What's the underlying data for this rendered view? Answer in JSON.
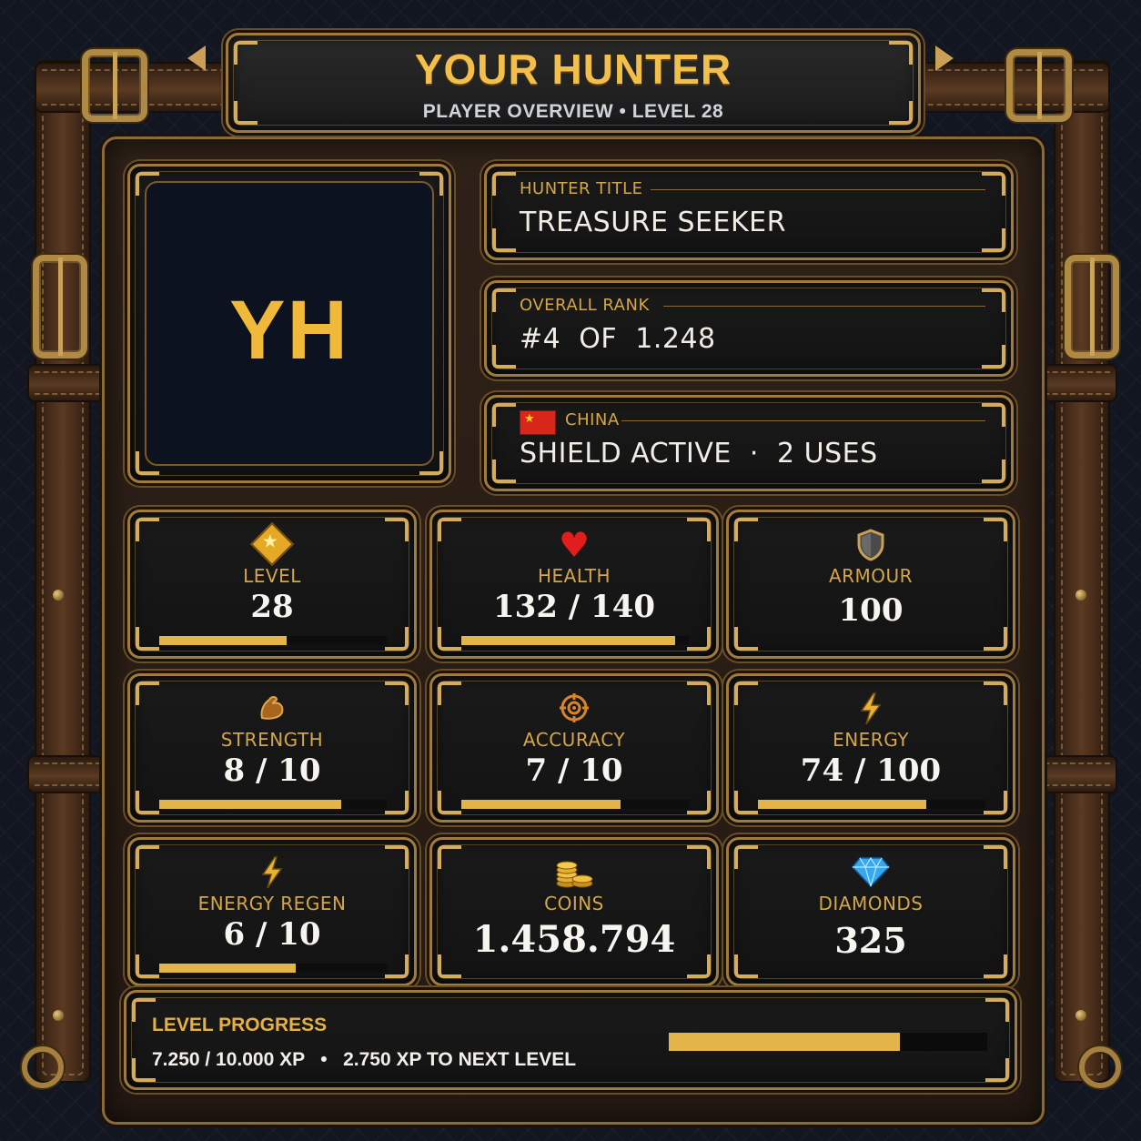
{
  "header": {
    "title": "YOUR HUNTER",
    "subtitle": "PLAYER OVERVIEW  •  LEVEL 28"
  },
  "avatar": {
    "initials": "YH"
  },
  "info": [
    {
      "label": "HUNTER TITLE",
      "value": "TREASURE SEEKER"
    },
    {
      "label": "OVERALL RANK",
      "value": "#4  OF  1.248"
    },
    {
      "label": "CHINA",
      "value": "SHIELD ACTIVE  ·  2 USES",
      "flag_icon": "china-flag-icon"
    }
  ],
  "stats": [
    {
      "name": "level",
      "label": "LEVEL",
      "value": "28",
      "icon": "star-icon",
      "fill": 0.56
    },
    {
      "name": "health",
      "label": "HEALTH",
      "value": "132 / 140",
      "icon": "heart-icon",
      "fill": 0.94
    },
    {
      "name": "armour",
      "label": "ARMOUR",
      "value": "100",
      "icon": "shield-icon",
      "fill": null
    },
    {
      "name": "strength",
      "label": "STRENGTH",
      "value": "8 / 10",
      "icon": "flexed-arm-icon",
      "fill": 0.8
    },
    {
      "name": "accuracy",
      "label": "ACCURACY",
      "value": "7 / 10",
      "icon": "crosshair-icon",
      "fill": 0.7
    },
    {
      "name": "energy",
      "label": "ENERGY",
      "value": "74 / 100",
      "icon": "lightning-icon",
      "fill": 0.74
    },
    {
      "name": "energy-regen",
      "label": "ENERGY REGEN",
      "value": "6 / 10",
      "icon": "lightning-icon",
      "fill": 0.6
    },
    {
      "name": "coins",
      "label": "COINS",
      "value": "1.458.794",
      "icon": "coins-icon",
      "fill": null
    },
    {
      "name": "diamonds",
      "label": "DIAMONDS",
      "value": "325",
      "icon": "diamond-icon",
      "fill": null
    }
  ],
  "progress": {
    "label": "LEVEL PROGRESS",
    "text": "7.250 / 10.000 XP   •   2.750 XP TO NEXT LEVEL",
    "fill": 0.725
  },
  "colors": {
    "gold": "#e3b44a",
    "value_text": "#f7f5ef",
    "label_gold": "#d4a647",
    "avatar_bg": "#0c1220"
  }
}
